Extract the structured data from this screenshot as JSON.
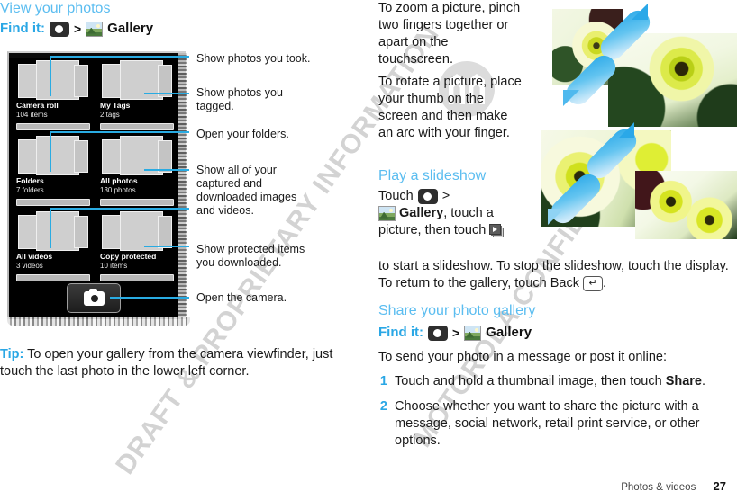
{
  "document": {
    "footer_section": "Photos & videos",
    "page_number": "27",
    "watermark_line_1": "MOTOROLA CONFIDENTIAL",
    "watermark_line_2": "DRAFT & PROPRIETARY INFORMATION",
    "accent_blue": "#29abe2",
    "heading_blue": "#5bbdf0"
  },
  "left": {
    "heading": "View your photos",
    "find_it": {
      "label": "Find it:",
      "separator": ">",
      "camera_icon": "camera-icon",
      "gallery_icon": "gallery-icon",
      "target": "Gallery"
    },
    "gallery_screen": {
      "tiles": [
        {
          "label": "Camera roll",
          "count": "104 items"
        },
        {
          "label": "My Tags",
          "count": "2 tags"
        },
        {
          "label": "Folders",
          "count": "7 folders"
        },
        {
          "label": "All photos",
          "count": "130 photos"
        },
        {
          "label": "All videos",
          "count": "3 videos"
        },
        {
          "label": "Copy protected",
          "count": "10 items"
        }
      ],
      "camera_button_icon": "camera-icon"
    },
    "callouts": [
      {
        "text": "Show photos you took."
      },
      {
        "text": "Show photos you\ntagged."
      },
      {
        "text": "Open your folders."
      },
      {
        "text": "Show all of your\ncaptured and\ndownloaded images\nand videos."
      },
      {
        "text": "Show protected items\nyou downloaded."
      },
      {
        "text": "Open the camera."
      }
    ],
    "tip": {
      "label": "Tip:",
      "text": " To open your gallery from the camera viewfinder, just touch the last photo in the lower left corner."
    }
  },
  "right": {
    "paragraph_zoom": "To zoom a picture, pinch two fingers together or apart on the touchscreen.",
    "paragraph_rotate": "To rotate a picture, place your thumb on the screen and then make an arc with your finger.",
    "slideshow_heading": "Play a slideshow",
    "slideshow": {
      "touch_word": "Touch",
      "camera_icon": "camera-icon",
      "separator": ">",
      "gallery_icon": "gallery-icon",
      "gallery_word": "Gallery",
      "after_gallery": ", touch a picture, then",
      "touch_word_2": "touch",
      "slideshow_icon": "slideshow-icon",
      "after_slideshow_icon": " to start a slideshow. To stop the slideshow, touch the display. To return to the gallery, touch Back",
      "back_icon": "back-arrow-icon",
      "period": "."
    },
    "share_heading": "Share your photo gallery",
    "share_find_it": {
      "label": "Find it:",
      "separator": ">",
      "camera_icon": "camera-icon",
      "gallery_icon": "gallery-icon",
      "target": "Gallery"
    },
    "share_intro": "To send your photo in a message or post it online:",
    "steps": [
      {
        "num": "1",
        "pre": "Touch and hold a thumbnail image, then touch ",
        "bold": "Share",
        "post": "."
      },
      {
        "num": "2",
        "pre": "Choose whether you want to share the picture with a message, social network, retail print service, or other options.",
        "bold": "",
        "post": ""
      }
    ],
    "photos": [
      {
        "name": "daffodil-photo-top-left"
      },
      {
        "name": "daffodil-photo-top-right"
      },
      {
        "name": "daffodil-photo-bottom-left"
      },
      {
        "name": "daffodil-photo-bottom-right"
      }
    ],
    "gesture_graphics": [
      {
        "name": "pinch-zoom-arrow-graphic"
      },
      {
        "name": "rotate-arc-arrow-graphic"
      }
    ]
  }
}
